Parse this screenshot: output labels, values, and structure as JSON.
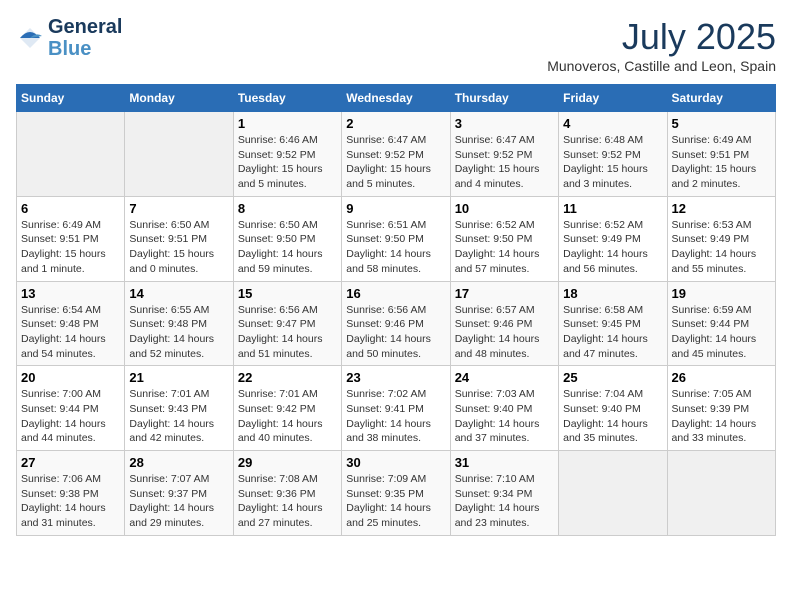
{
  "header": {
    "logo_line1": "General",
    "logo_line2": "Blue",
    "month_year": "July 2025",
    "location": "Munoveros, Castille and Leon, Spain"
  },
  "columns": [
    "Sunday",
    "Monday",
    "Tuesday",
    "Wednesday",
    "Thursday",
    "Friday",
    "Saturday"
  ],
  "weeks": [
    [
      {
        "day": "",
        "info": ""
      },
      {
        "day": "",
        "info": ""
      },
      {
        "day": "1",
        "info": "Sunrise: 6:46 AM\nSunset: 9:52 PM\nDaylight: 15 hours and 5 minutes."
      },
      {
        "day": "2",
        "info": "Sunrise: 6:47 AM\nSunset: 9:52 PM\nDaylight: 15 hours and 5 minutes."
      },
      {
        "day": "3",
        "info": "Sunrise: 6:47 AM\nSunset: 9:52 PM\nDaylight: 15 hours and 4 minutes."
      },
      {
        "day": "4",
        "info": "Sunrise: 6:48 AM\nSunset: 9:52 PM\nDaylight: 15 hours and 3 minutes."
      },
      {
        "day": "5",
        "info": "Sunrise: 6:49 AM\nSunset: 9:51 PM\nDaylight: 15 hours and 2 minutes."
      }
    ],
    [
      {
        "day": "6",
        "info": "Sunrise: 6:49 AM\nSunset: 9:51 PM\nDaylight: 15 hours and 1 minute."
      },
      {
        "day": "7",
        "info": "Sunrise: 6:50 AM\nSunset: 9:51 PM\nDaylight: 15 hours and 0 minutes."
      },
      {
        "day": "8",
        "info": "Sunrise: 6:50 AM\nSunset: 9:50 PM\nDaylight: 14 hours and 59 minutes."
      },
      {
        "day": "9",
        "info": "Sunrise: 6:51 AM\nSunset: 9:50 PM\nDaylight: 14 hours and 58 minutes."
      },
      {
        "day": "10",
        "info": "Sunrise: 6:52 AM\nSunset: 9:50 PM\nDaylight: 14 hours and 57 minutes."
      },
      {
        "day": "11",
        "info": "Sunrise: 6:52 AM\nSunset: 9:49 PM\nDaylight: 14 hours and 56 minutes."
      },
      {
        "day": "12",
        "info": "Sunrise: 6:53 AM\nSunset: 9:49 PM\nDaylight: 14 hours and 55 minutes."
      }
    ],
    [
      {
        "day": "13",
        "info": "Sunrise: 6:54 AM\nSunset: 9:48 PM\nDaylight: 14 hours and 54 minutes."
      },
      {
        "day": "14",
        "info": "Sunrise: 6:55 AM\nSunset: 9:48 PM\nDaylight: 14 hours and 52 minutes."
      },
      {
        "day": "15",
        "info": "Sunrise: 6:56 AM\nSunset: 9:47 PM\nDaylight: 14 hours and 51 minutes."
      },
      {
        "day": "16",
        "info": "Sunrise: 6:56 AM\nSunset: 9:46 PM\nDaylight: 14 hours and 50 minutes."
      },
      {
        "day": "17",
        "info": "Sunrise: 6:57 AM\nSunset: 9:46 PM\nDaylight: 14 hours and 48 minutes."
      },
      {
        "day": "18",
        "info": "Sunrise: 6:58 AM\nSunset: 9:45 PM\nDaylight: 14 hours and 47 minutes."
      },
      {
        "day": "19",
        "info": "Sunrise: 6:59 AM\nSunset: 9:44 PM\nDaylight: 14 hours and 45 minutes."
      }
    ],
    [
      {
        "day": "20",
        "info": "Sunrise: 7:00 AM\nSunset: 9:44 PM\nDaylight: 14 hours and 44 minutes."
      },
      {
        "day": "21",
        "info": "Sunrise: 7:01 AM\nSunset: 9:43 PM\nDaylight: 14 hours and 42 minutes."
      },
      {
        "day": "22",
        "info": "Sunrise: 7:01 AM\nSunset: 9:42 PM\nDaylight: 14 hours and 40 minutes."
      },
      {
        "day": "23",
        "info": "Sunrise: 7:02 AM\nSunset: 9:41 PM\nDaylight: 14 hours and 38 minutes."
      },
      {
        "day": "24",
        "info": "Sunrise: 7:03 AM\nSunset: 9:40 PM\nDaylight: 14 hours and 37 minutes."
      },
      {
        "day": "25",
        "info": "Sunrise: 7:04 AM\nSunset: 9:40 PM\nDaylight: 14 hours and 35 minutes."
      },
      {
        "day": "26",
        "info": "Sunrise: 7:05 AM\nSunset: 9:39 PM\nDaylight: 14 hours and 33 minutes."
      }
    ],
    [
      {
        "day": "27",
        "info": "Sunrise: 7:06 AM\nSunset: 9:38 PM\nDaylight: 14 hours and 31 minutes."
      },
      {
        "day": "28",
        "info": "Sunrise: 7:07 AM\nSunset: 9:37 PM\nDaylight: 14 hours and 29 minutes."
      },
      {
        "day": "29",
        "info": "Sunrise: 7:08 AM\nSunset: 9:36 PM\nDaylight: 14 hours and 27 minutes."
      },
      {
        "day": "30",
        "info": "Sunrise: 7:09 AM\nSunset: 9:35 PM\nDaylight: 14 hours and 25 minutes."
      },
      {
        "day": "31",
        "info": "Sunrise: 7:10 AM\nSunset: 9:34 PM\nDaylight: 14 hours and 23 minutes."
      },
      {
        "day": "",
        "info": ""
      },
      {
        "day": "",
        "info": ""
      }
    ]
  ]
}
